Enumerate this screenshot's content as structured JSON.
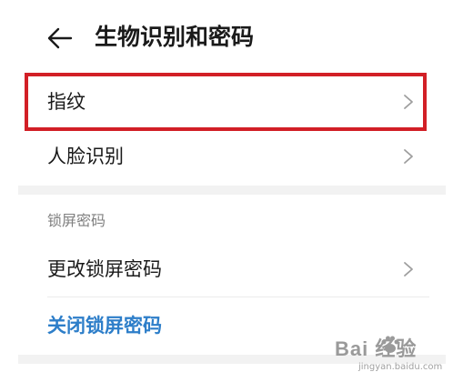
{
  "header": {
    "title": "生物识别和密码"
  },
  "list": {
    "fingerprint": "指纹",
    "face_recognition": "人脸识别"
  },
  "lock_screen": {
    "section_title": "锁屏密码",
    "change_password": "更改锁屏密码",
    "disable_password": "关闭锁屏密码"
  },
  "watermark": {
    "logo": "Bai 经验",
    "url": "jingyan.baidu.com"
  },
  "colors": {
    "highlight": "#d21f26",
    "link": "#2d7ec9",
    "chevron": "#9e9e9e"
  }
}
